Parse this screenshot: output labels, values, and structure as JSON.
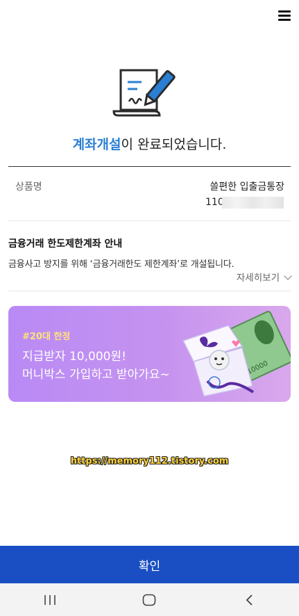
{
  "header": {
    "menu_icon": "hamburger-menu-icon"
  },
  "completion": {
    "highlight": "계좌개설",
    "rest": "이 완료되었습니다.",
    "icon": "document-pen-icon",
    "accent_color": "#2a7fd4"
  },
  "product": {
    "label": "상품명",
    "name": "쓸편한 입출금통장",
    "account_prefix": "110-"
  },
  "limit_notice": {
    "title": "금융거래 한도제한계좌 안내",
    "description": "금융사고 방지를 위해 ‘금융거래한도 제한계좌’로 개설됩니다.",
    "detail_link": "자세히보기",
    "detail_icon": "chevron-down-icon"
  },
  "banner": {
    "tag": "#20대 한정",
    "line1": "지급받자 10,000원!",
    "line2": "머니박스 가입하고 받아가요~",
    "art_icon": "gift-box-money-icon"
  },
  "watermark": "https://memory112.tistory.com",
  "confirm": {
    "label": "확인",
    "color": "#1a4fc4"
  },
  "navbar": {
    "recent_icon": "recent-apps-icon",
    "home_icon": "home-icon",
    "back_icon": "back-icon"
  }
}
